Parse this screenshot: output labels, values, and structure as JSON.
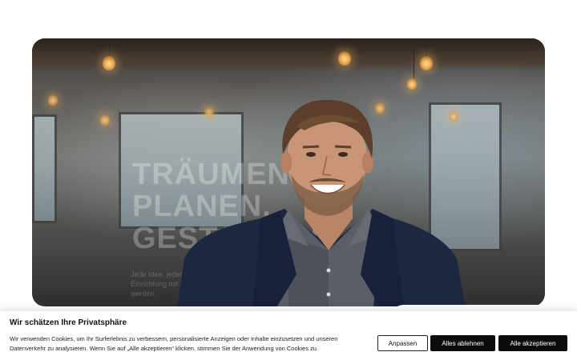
{
  "hero": {
    "title": "TRÄUMEN.\nPLANEN.\nGESTALTEN.",
    "subtitle": "Jede Idee, jeder Raum oder bei der Planung unser eine Einrichtung mit innovative Lösungen ... Vorstellungen werden."
  },
  "cookie": {
    "title": "Wir schätzen Ihre Privatsphäre",
    "text": "Wir verwenden Cookies, um Ihr Surferlebnis zu verbessern, personalisierte Anzeigen oder Inhalte einzusetzen und unseren Datenverkehr zu analysieren. Wenn Sie auf „Alle akzeptieren“ klicken, stimmen Sie der Anwendung von Cookies zu.",
    "customize_label": "Anpassen",
    "reject_label": "Alles ablehnen",
    "accept_label": "Alle akzeptieren"
  },
  "colors": {
    "button_dark": "#0c0c0c",
    "banner_bg": "#ffffff"
  }
}
